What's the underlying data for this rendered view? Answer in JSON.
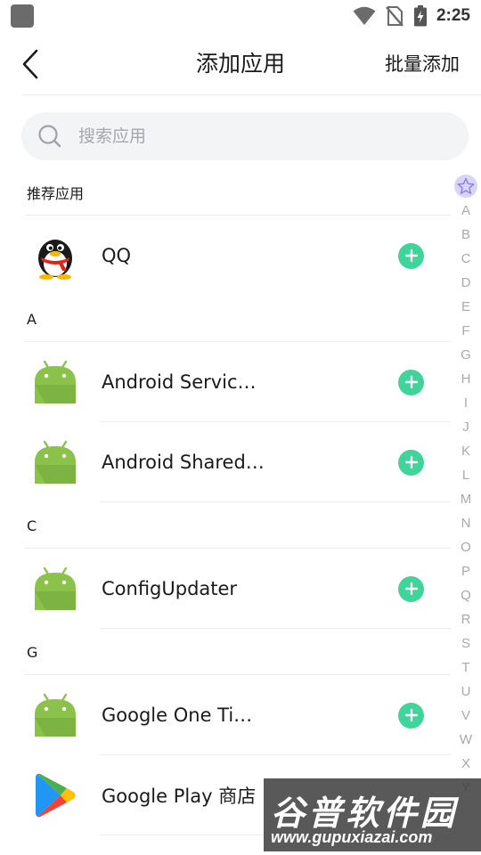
{
  "status_bar": {
    "time": "2:25"
  },
  "header": {
    "title": "添加应用",
    "batch_add": "批量添加"
  },
  "search": {
    "placeholder": "搜索应用"
  },
  "sections": [
    {
      "label": "推荐应用",
      "apps": [
        {
          "name": "QQ",
          "icon": "qq-penguin-icon"
        }
      ]
    },
    {
      "label": "A",
      "apps": [
        {
          "name": "Android Servic…",
          "icon": "android-icon"
        },
        {
          "name": "Android Shared…",
          "icon": "android-icon"
        }
      ]
    },
    {
      "label": "C",
      "apps": [
        {
          "name": "ConfigUpdater",
          "icon": "android-icon"
        }
      ]
    },
    {
      "label": "G",
      "apps": [
        {
          "name": "Google One Ti…",
          "icon": "android-icon"
        },
        {
          "name": "Google Play 商店",
          "icon": "google-play-icon"
        }
      ]
    }
  ],
  "index_bar": {
    "star": "☆",
    "letters": [
      "A",
      "B",
      "C",
      "D",
      "E",
      "F",
      "G",
      "H",
      "I",
      "J",
      "K",
      "L",
      "M",
      "N",
      "O",
      "P",
      "Q",
      "R",
      "S",
      "T",
      "U",
      "V",
      "W",
      "X",
      "Y"
    ]
  },
  "watermark": {
    "title": "谷普软件园",
    "url": "www.gupuxiazai.com"
  },
  "colors": {
    "accent_green": "#3ed49a",
    "android_green": "#8bc34a",
    "index_highlight": "#d8d4f6"
  }
}
